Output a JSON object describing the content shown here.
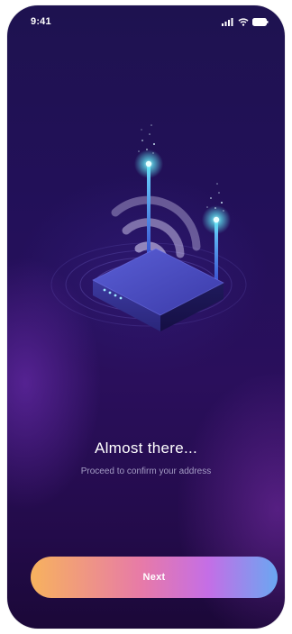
{
  "status_bar": {
    "time": "9:41",
    "icons": [
      "signal-icon",
      "wifi-icon",
      "battery-icon"
    ]
  },
  "illustration": {
    "subject": "router-icon"
  },
  "content": {
    "title": "Almost there...",
    "subtitle": "Proceed to confirm your address"
  },
  "actions": {
    "next_label": "Next"
  },
  "colors": {
    "background_top": "#1e1250",
    "background_bottom": "#1b0838",
    "button_gradient": [
      "#f7b25e",
      "#e77aa8",
      "#c46ee6",
      "#6aa7f2"
    ],
    "accent_glow": "#5fe3f0"
  }
}
